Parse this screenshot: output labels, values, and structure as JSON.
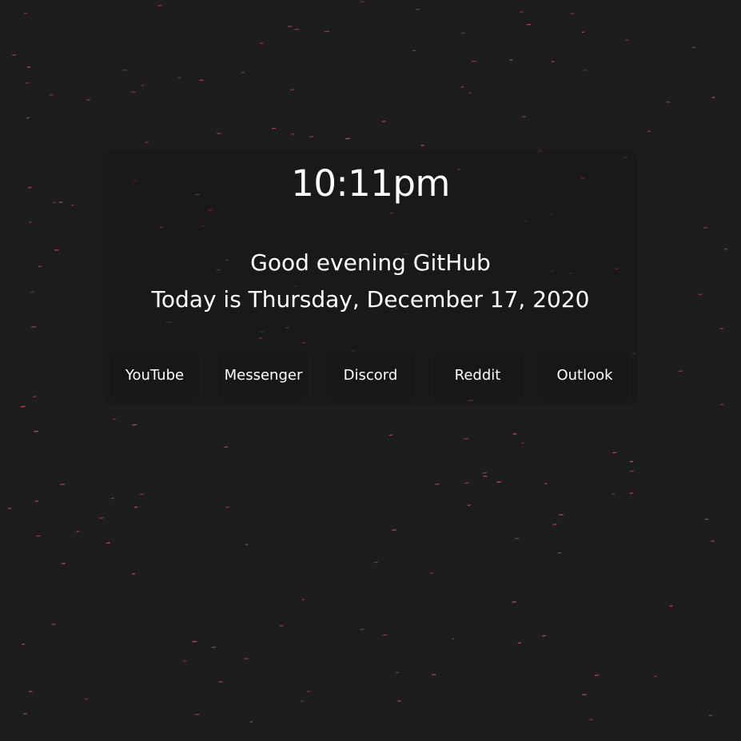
{
  "clock": {
    "time": "10:11pm"
  },
  "greeting": {
    "message": "Good evening GitHub",
    "date_line": "Today is Thursday, December 17, 2020"
  },
  "links": [
    {
      "label": "YouTube"
    },
    {
      "label": "Messenger"
    },
    {
      "label": "Discord"
    },
    {
      "label": "Reddit"
    },
    {
      "label": "Outlook"
    }
  ],
  "colors": {
    "background": "#1e1d1e",
    "card": "#171617",
    "button": "#181718",
    "text": "#ffffff",
    "particle": "#c0505c"
  }
}
